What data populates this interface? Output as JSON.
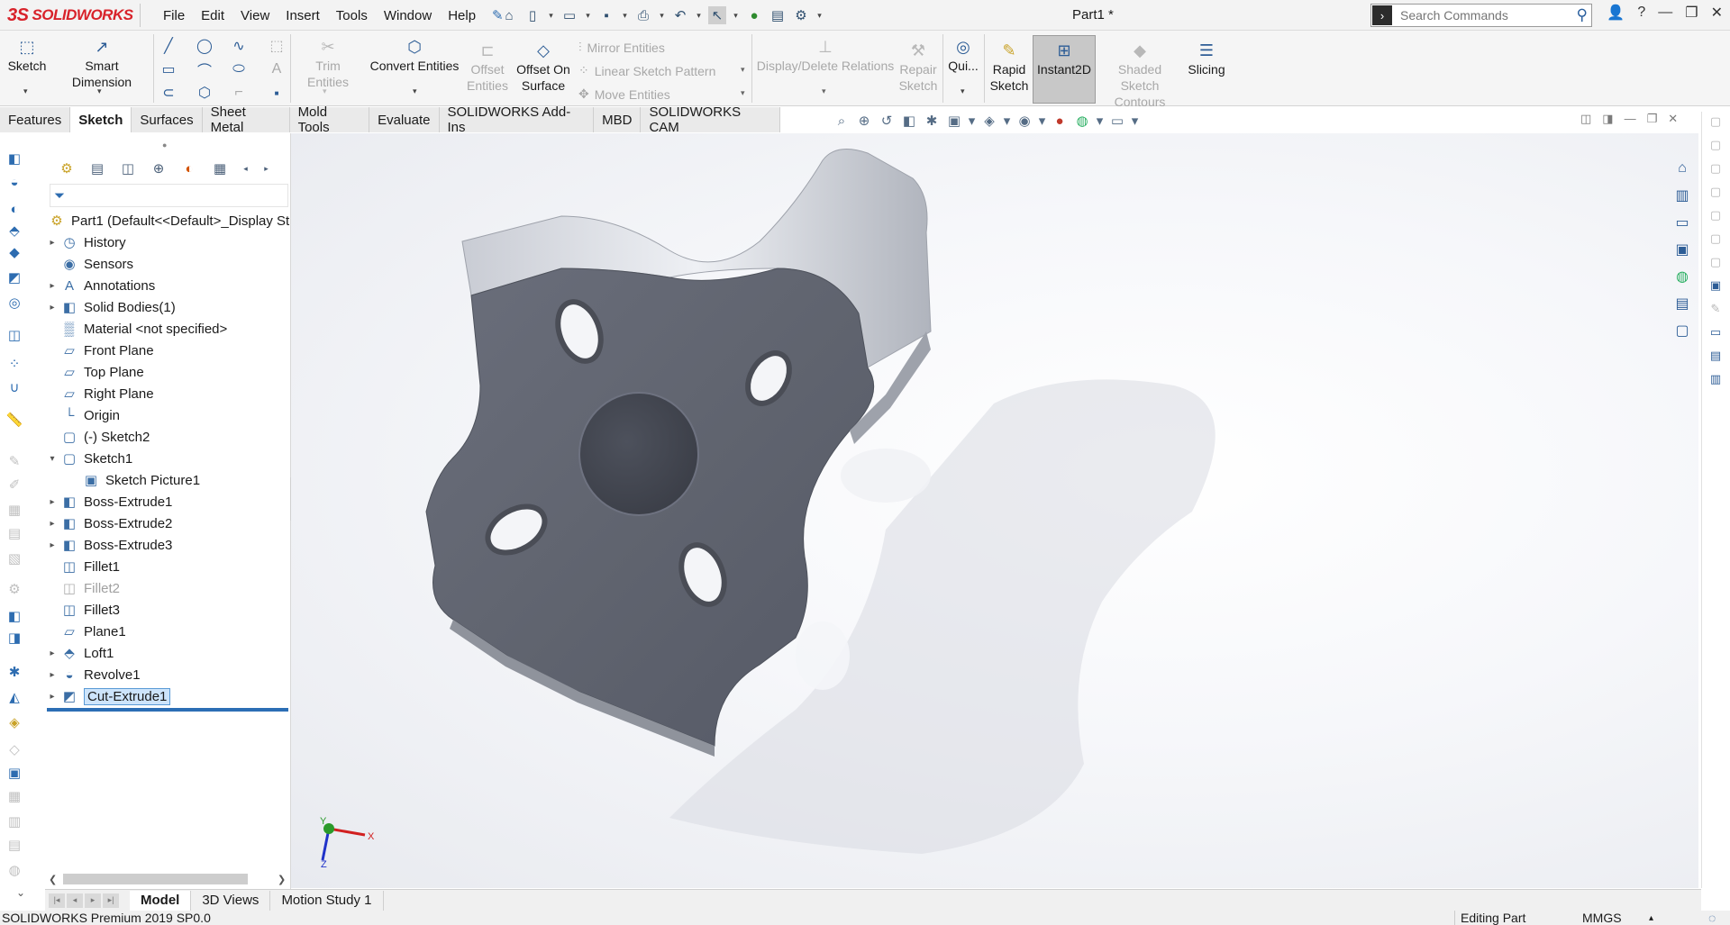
{
  "app": {
    "brand": "SOLIDWORKS",
    "doc_title": "Part1 *"
  },
  "menu": [
    "File",
    "Edit",
    "View",
    "Insert",
    "Tools",
    "Window",
    "Help"
  ],
  "search": {
    "placeholder": "Search Commands"
  },
  "ribbon": {
    "sketch": "Sketch",
    "smart_dimension": "Smart Dimension",
    "trim_entities": "Trim Entities",
    "convert_entities": "Convert Entities",
    "offset_entities_1": "Offset",
    "offset_entities_2": "Entities",
    "offset_on_surface_1": "Offset On",
    "offset_on_surface_2": "Surface",
    "mirror_entities": "Mirror Entities",
    "linear_sketch_pattern": "Linear Sketch Pattern",
    "move_entities": "Move Entities",
    "display_delete_relations": "Display/Delete Relations",
    "repair_sketch_1": "Repair",
    "repair_sketch_2": "Sketch",
    "quick_snaps": "Qui...",
    "rapid_sketch_1": "Rapid",
    "rapid_sketch_2": "Sketch",
    "instant2d": "Instant2D",
    "shaded_sketch_1": "Shaded Sketch",
    "shaded_sketch_2": "Contours",
    "slicing": "Slicing"
  },
  "cm_tabs": [
    "Features",
    "Sketch",
    "Surfaces",
    "Sheet Metal",
    "Mold Tools",
    "Evaluate",
    "SOLIDWORKS Add-Ins",
    "MBD",
    "SOLIDWORKS CAM"
  ],
  "active_cm_tab": "Sketch",
  "tree": {
    "root": "Part1  (Default<<Default>_Display St",
    "items": [
      {
        "label": "History",
        "expand": true,
        "icon": "history-icon"
      },
      {
        "label": "Sensors",
        "expand": false,
        "icon": "sensor-icon"
      },
      {
        "label": "Annotations",
        "expand": true,
        "icon": "annotations-icon"
      },
      {
        "label": "Solid Bodies(1)",
        "expand": true,
        "icon": "solid-bodies-icon"
      },
      {
        "label": "Material <not specified>",
        "expand": false,
        "icon": "material-icon"
      },
      {
        "label": "Front Plane",
        "expand": false,
        "icon": "plane-icon"
      },
      {
        "label": "Top Plane",
        "expand": false,
        "icon": "plane-icon"
      },
      {
        "label": "Right Plane",
        "expand": false,
        "icon": "plane-icon"
      },
      {
        "label": "Origin",
        "expand": false,
        "icon": "origin-icon"
      },
      {
        "label": "(-) Sketch2",
        "expand": false,
        "icon": "sketch-icon"
      },
      {
        "label": "Sketch1",
        "expand": "open",
        "icon": "sketch-icon"
      },
      {
        "label": "Sketch Picture1",
        "expand": false,
        "icon": "picture-icon",
        "indent": true
      },
      {
        "label": "Boss-Extrude1",
        "expand": true,
        "icon": "extrude-icon"
      },
      {
        "label": "Boss-Extrude2",
        "expand": true,
        "icon": "extrude-icon"
      },
      {
        "label": "Boss-Extrude3",
        "expand": true,
        "icon": "extrude-icon"
      },
      {
        "label": "Fillet1",
        "expand": false,
        "icon": "fillet-icon"
      },
      {
        "label": "Fillet2",
        "expand": false,
        "icon": "fillet-icon",
        "dim": true
      },
      {
        "label": "Fillet3",
        "expand": false,
        "icon": "fillet-icon"
      },
      {
        "label": "Plane1",
        "expand": false,
        "icon": "plane-icon"
      },
      {
        "label": "Loft1",
        "expand": true,
        "icon": "loft-icon"
      },
      {
        "label": "Revolve1",
        "expand": true,
        "icon": "revolve-icon"
      },
      {
        "label": "Cut-Extrude1",
        "expand": true,
        "icon": "cut-extrude-icon",
        "selected": true
      }
    ]
  },
  "bottom_tabs": [
    "Model",
    "3D Views",
    "Motion Study 1"
  ],
  "active_bottom_tab": "Model",
  "status": {
    "left": "SOLIDWORKS Premium 2019 SP0.0",
    "mode": "Editing Part",
    "units": "MMGS"
  },
  "triad": {
    "y": "Y",
    "x": "X",
    "z": "Z"
  },
  "colors": {
    "brand": "#d8222a",
    "accent": "#2d5d96",
    "selection": "#5a9ad6"
  }
}
